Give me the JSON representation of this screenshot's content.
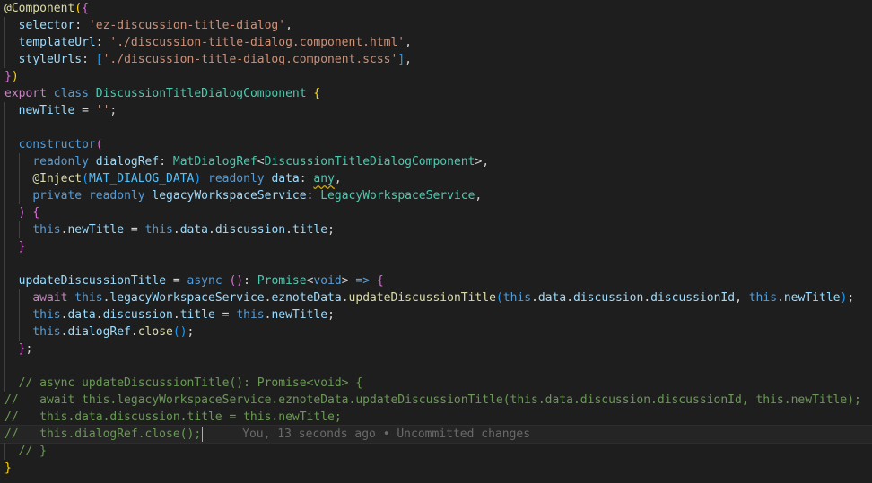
{
  "editor": {
    "lines": [
      {
        "indent": 0,
        "tokens": [
          [
            "@Component",
            "#dcdcaa"
          ],
          [
            "(",
            "#ffd700"
          ],
          [
            "{",
            "#da70d6"
          ]
        ]
      },
      {
        "indent": 1,
        "tokens": [
          [
            "selector",
            "#9cdcfe"
          ],
          [
            ": ",
            "#d4d4d4"
          ],
          [
            "'ez-discussion-title-dialog'",
            "#ce9178"
          ],
          [
            ",",
            "#d4d4d4"
          ]
        ]
      },
      {
        "indent": 1,
        "tokens": [
          [
            "templateUrl",
            "#9cdcfe"
          ],
          [
            ": ",
            "#d4d4d4"
          ],
          [
            "'./discussion-title-dialog.component.html'",
            "#ce9178"
          ],
          [
            ",",
            "#d4d4d4"
          ]
        ]
      },
      {
        "indent": 1,
        "tokens": [
          [
            "styleUrls",
            "#9cdcfe"
          ],
          [
            ": ",
            "#d4d4d4"
          ],
          [
            "[",
            "#179fff"
          ],
          [
            "'./discussion-title-dialog.component.scss'",
            "#ce9178"
          ],
          [
            "]",
            "#179fff"
          ],
          [
            ",",
            "#d4d4d4"
          ]
        ]
      },
      {
        "indent": 0,
        "tokens": [
          [
            "}",
            "#da70d6"
          ],
          [
            ")",
            "#ffd700"
          ]
        ]
      },
      {
        "indent": 0,
        "tokens": [
          [
            "export",
            "#c586c0"
          ],
          [
            " ",
            "#d4d4d4"
          ],
          [
            "class",
            "#569cd6"
          ],
          [
            " ",
            "#d4d4d4"
          ],
          [
            "DiscussionTitleDialogComponent",
            "#4ec9b0"
          ],
          [
            " ",
            "#d4d4d4"
          ],
          [
            "{",
            "#ffd700"
          ]
        ]
      },
      {
        "indent": 1,
        "tokens": [
          [
            "newTitle",
            "#9cdcfe"
          ],
          [
            " = ",
            "#d4d4d4"
          ],
          [
            "''",
            "#ce9178"
          ],
          [
            ";",
            "#d4d4d4"
          ]
        ]
      },
      {
        "indent": 1,
        "tokens": []
      },
      {
        "indent": 1,
        "tokens": [
          [
            "constructor",
            "#569cd6"
          ],
          [
            "(",
            "#da70d6"
          ]
        ]
      },
      {
        "indent": 2,
        "tokens": [
          [
            "readonly",
            "#569cd6"
          ],
          [
            " ",
            "#d4d4d4"
          ],
          [
            "dialogRef",
            "#9cdcfe"
          ],
          [
            ": ",
            "#d4d4d4"
          ],
          [
            "MatDialogRef",
            "#4ec9b0"
          ],
          [
            "<",
            "#d4d4d4"
          ],
          [
            "DiscussionTitleDialogComponent",
            "#4ec9b0"
          ],
          [
            ">",
            "#d4d4d4"
          ],
          [
            ",",
            "#d4d4d4"
          ]
        ]
      },
      {
        "indent": 2,
        "tokens": [
          [
            "@Inject",
            "#dcdcaa"
          ],
          [
            "(",
            "#179fff"
          ],
          [
            "MAT_DIALOG_DATA",
            "#4fc1ff"
          ],
          [
            ")",
            "#179fff"
          ],
          [
            " ",
            "#d4d4d4"
          ],
          [
            "readonly",
            "#569cd6"
          ],
          [
            " ",
            "#d4d4d4"
          ],
          [
            "data",
            "#9cdcfe"
          ],
          [
            ": ",
            "#d4d4d4"
          ],
          [
            "any",
            "#4ec9b0",
            "squiggle"
          ],
          [
            ",",
            "#d4d4d4"
          ]
        ]
      },
      {
        "indent": 2,
        "tokens": [
          [
            "private",
            "#569cd6"
          ],
          [
            " ",
            "#d4d4d4"
          ],
          [
            "readonly",
            "#569cd6"
          ],
          [
            " ",
            "#d4d4d4"
          ],
          [
            "legacyWorkspaceService",
            "#9cdcfe"
          ],
          [
            ": ",
            "#d4d4d4"
          ],
          [
            "LegacyWorkspaceService",
            "#4ec9b0"
          ],
          [
            ",",
            "#d4d4d4"
          ]
        ]
      },
      {
        "indent": 1,
        "tokens": [
          [
            ")",
            "#da70d6"
          ],
          [
            " ",
            "#d4d4d4"
          ],
          [
            "{",
            "#da70d6"
          ]
        ]
      },
      {
        "indent": 2,
        "tokens": [
          [
            "this",
            "#569cd6"
          ],
          [
            ".",
            "#d4d4d4"
          ],
          [
            "newTitle",
            "#9cdcfe"
          ],
          [
            " = ",
            "#d4d4d4"
          ],
          [
            "this",
            "#569cd6"
          ],
          [
            ".",
            "#d4d4d4"
          ],
          [
            "data",
            "#9cdcfe"
          ],
          [
            ".",
            "#d4d4d4"
          ],
          [
            "discussion",
            "#9cdcfe"
          ],
          [
            ".",
            "#d4d4d4"
          ],
          [
            "title",
            "#9cdcfe"
          ],
          [
            ";",
            "#d4d4d4"
          ]
        ]
      },
      {
        "indent": 1,
        "tokens": [
          [
            "}",
            "#da70d6"
          ]
        ]
      },
      {
        "indent": 1,
        "tokens": []
      },
      {
        "indent": 1,
        "tokens": [
          [
            "updateDiscussionTitle",
            "#9cdcfe"
          ],
          [
            " = ",
            "#d4d4d4"
          ],
          [
            "async",
            "#569cd6"
          ],
          [
            " ",
            "#d4d4d4"
          ],
          [
            "()",
            "#da70d6"
          ],
          [
            ": ",
            "#d4d4d4"
          ],
          [
            "Promise",
            "#4ec9b0"
          ],
          [
            "<",
            "#d4d4d4"
          ],
          [
            "void",
            "#569cd6"
          ],
          [
            ">",
            "#d4d4d4"
          ],
          [
            " ",
            "#d4d4d4"
          ],
          [
            "=>",
            "#569cd6"
          ],
          [
            " ",
            "#d4d4d4"
          ],
          [
            "{",
            "#da70d6"
          ]
        ]
      },
      {
        "indent": 2,
        "tokens": [
          [
            "await",
            "#c586c0"
          ],
          [
            " ",
            "#d4d4d4"
          ],
          [
            "this",
            "#569cd6"
          ],
          [
            ".",
            "#d4d4d4"
          ],
          [
            "legacyWorkspaceService",
            "#9cdcfe"
          ],
          [
            ".",
            "#d4d4d4"
          ],
          [
            "eznoteData",
            "#9cdcfe"
          ],
          [
            ".",
            "#d4d4d4"
          ],
          [
            "updateDiscussionTitle",
            "#dcdcaa"
          ],
          [
            "(",
            "#179fff"
          ],
          [
            "this",
            "#569cd6"
          ],
          [
            ".",
            "#d4d4d4"
          ],
          [
            "data",
            "#9cdcfe"
          ],
          [
            ".",
            "#d4d4d4"
          ],
          [
            "discussion",
            "#9cdcfe"
          ],
          [
            ".",
            "#d4d4d4"
          ],
          [
            "discussionId",
            "#9cdcfe"
          ],
          [
            ", ",
            "#d4d4d4"
          ],
          [
            "this",
            "#569cd6"
          ],
          [
            ".",
            "#d4d4d4"
          ],
          [
            "newTitle",
            "#9cdcfe"
          ],
          [
            ")",
            "#179fff"
          ],
          [
            ";",
            "#d4d4d4"
          ]
        ]
      },
      {
        "indent": 2,
        "tokens": [
          [
            "this",
            "#569cd6"
          ],
          [
            ".",
            "#d4d4d4"
          ],
          [
            "data",
            "#9cdcfe"
          ],
          [
            ".",
            "#d4d4d4"
          ],
          [
            "discussion",
            "#9cdcfe"
          ],
          [
            ".",
            "#d4d4d4"
          ],
          [
            "title",
            "#9cdcfe"
          ],
          [
            " = ",
            "#d4d4d4"
          ],
          [
            "this",
            "#569cd6"
          ],
          [
            ".",
            "#d4d4d4"
          ],
          [
            "newTitle",
            "#9cdcfe"
          ],
          [
            ";",
            "#d4d4d4"
          ]
        ]
      },
      {
        "indent": 2,
        "tokens": [
          [
            "this",
            "#569cd6"
          ],
          [
            ".",
            "#d4d4d4"
          ],
          [
            "dialogRef",
            "#9cdcfe"
          ],
          [
            ".",
            "#d4d4d4"
          ],
          [
            "close",
            "#dcdcaa"
          ],
          [
            "()",
            "#179fff"
          ],
          [
            ";",
            "#d4d4d4"
          ]
        ]
      },
      {
        "indent": 1,
        "tokens": [
          [
            "}",
            "#da70d6"
          ],
          [
            ";",
            "#d4d4d4"
          ]
        ]
      },
      {
        "indent": 1,
        "tokens": []
      },
      {
        "indent": 1,
        "tokens": [
          [
            "// async updateDiscussionTitle(): Promise<void> {",
            "#6a9955"
          ]
        ]
      },
      {
        "indent": 0,
        "tokens": [
          [
            "//   await this.legacyWorkspaceService.eznoteData.updateDiscussionTitle(this.data.discussion.discussionId, this.newTitle);",
            "#6a9955"
          ]
        ]
      },
      {
        "indent": 0,
        "tokens": [
          [
            "//   this.data.discussion.title = this.newTitle;",
            "#6a9955"
          ]
        ]
      },
      {
        "indent": 0,
        "tokens": [
          [
            "//   this.dialogRef.close();",
            "#6a9955"
          ]
        ],
        "current": true,
        "blame": "You, 13 seconds ago • Uncommitted changes"
      },
      {
        "indent": 1,
        "tokens": [
          [
            "// }",
            "#6a9955"
          ]
        ]
      },
      {
        "indent": 0,
        "tokens": [
          [
            "}",
            "#ffd700"
          ]
        ]
      }
    ]
  },
  "colors": {
    "background": "#1e1e1e",
    "indent_guide": "#404040",
    "current_line": "#252525",
    "blame": "#6a6a6a"
  }
}
